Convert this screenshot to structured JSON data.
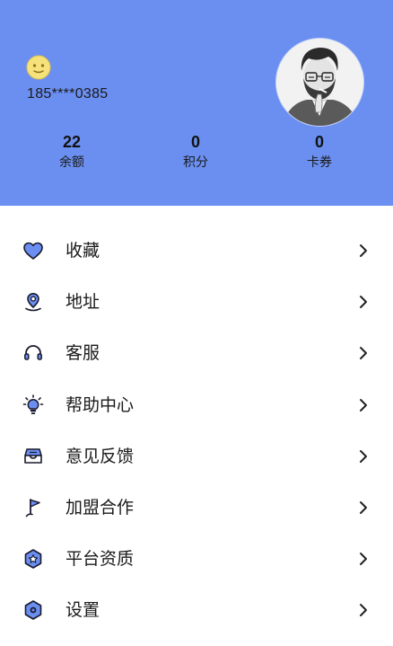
{
  "profile": {
    "phone": "185****0385"
  },
  "stats": [
    {
      "value": "22",
      "label": "余额"
    },
    {
      "value": "0",
      "label": "积分"
    },
    {
      "value": "0",
      "label": "卡券"
    }
  ],
  "menu": [
    {
      "label": "收藏",
      "icon": "heart-icon"
    },
    {
      "label": "地址",
      "icon": "location-pin-icon"
    },
    {
      "label": "客服",
      "icon": "headset-icon"
    },
    {
      "label": "帮助中心",
      "icon": "lightbulb-icon"
    },
    {
      "label": "意见反馈",
      "icon": "inbox-icon"
    },
    {
      "label": "加盟合作",
      "icon": "flag-icon"
    },
    {
      "label": "平台资质",
      "icon": "star-badge-icon"
    },
    {
      "label": "设置",
      "icon": "gear-icon"
    }
  ],
  "colors": {
    "header_bg": "#6b8ff0",
    "icon_fill": "#6b8ff0",
    "icon_stroke": "#1a1a2e"
  }
}
